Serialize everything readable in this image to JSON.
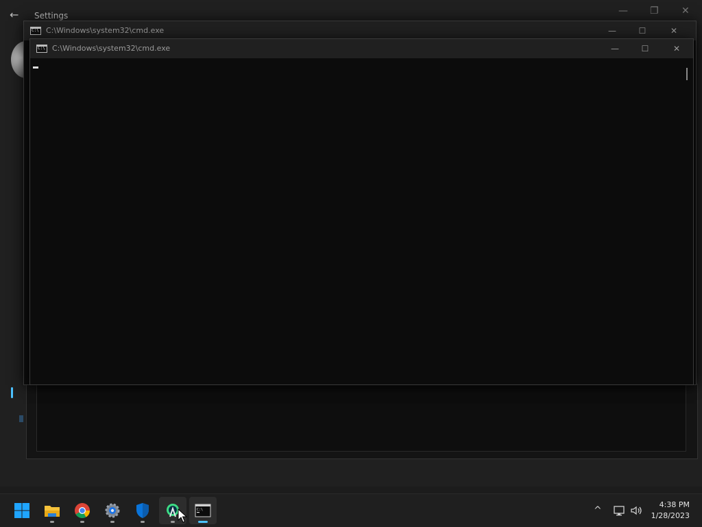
{
  "settings_window": {
    "title": "Settings",
    "back_icon": "arrow-left-icon",
    "minimize_icon": "minimize-icon",
    "restore_icon": "restore-icon",
    "close_icon": "close-icon"
  },
  "cmd_windows": [
    {
      "title": "C:\\Windows\\system32\\cmd.exe"
    },
    {
      "title": "C:\\Windows\\system32\\cmd.exe"
    }
  ],
  "window_controls": {
    "minimize": "—",
    "maximize": "☐",
    "close": "✕"
  },
  "taskbar": {
    "items": [
      {
        "name": "start",
        "icon": "windows-logo-icon"
      },
      {
        "name": "file-explorer",
        "icon": "folder-icon"
      },
      {
        "name": "chrome",
        "icon": "chrome-icon"
      },
      {
        "name": "settings",
        "icon": "gear-icon"
      },
      {
        "name": "windows-security",
        "icon": "shield-icon"
      },
      {
        "name": "android-studio",
        "icon": "android-studio-icon"
      },
      {
        "name": "terminal",
        "icon": "terminal-icon"
      }
    ],
    "tray": {
      "chevron": "^",
      "network_icon": "network-icon",
      "volume_icon": "volume-icon"
    },
    "clock": {
      "time": "4:38 PM",
      "date": "1/28/2023"
    }
  }
}
